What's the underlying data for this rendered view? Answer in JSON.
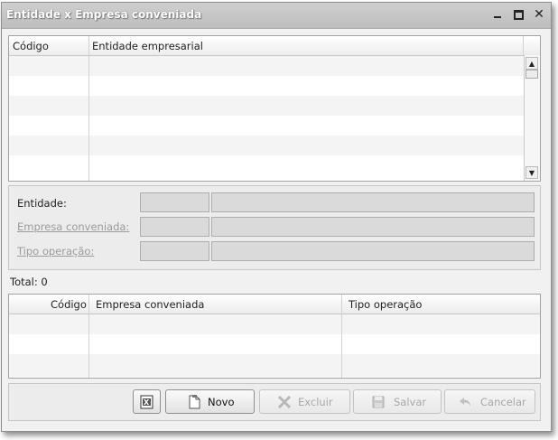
{
  "window": {
    "title": "Entidade x Empresa conveniada"
  },
  "top_grid": {
    "columns": [
      "Código",
      "Entidade empresarial"
    ]
  },
  "form": {
    "entidade_label": "Entidade:",
    "empresa_label": "Empresa conveniada:",
    "tipo_label": "Tipo operação:"
  },
  "total_label": "Total: 0",
  "bottom_grid": {
    "columns": [
      "Código",
      "Empresa conveniada",
      "Tipo operação"
    ]
  },
  "toolbar": {
    "novo": "Novo",
    "excluir": "Excluir",
    "salvar": "Salvar",
    "cancelar": "Cancelar"
  },
  "icons": {
    "export": "excel-export-icon",
    "new": "new-document-icon",
    "delete": "delete-x-icon",
    "save": "floppy-disk-icon",
    "cancel": "undo-arrow-icon"
  }
}
